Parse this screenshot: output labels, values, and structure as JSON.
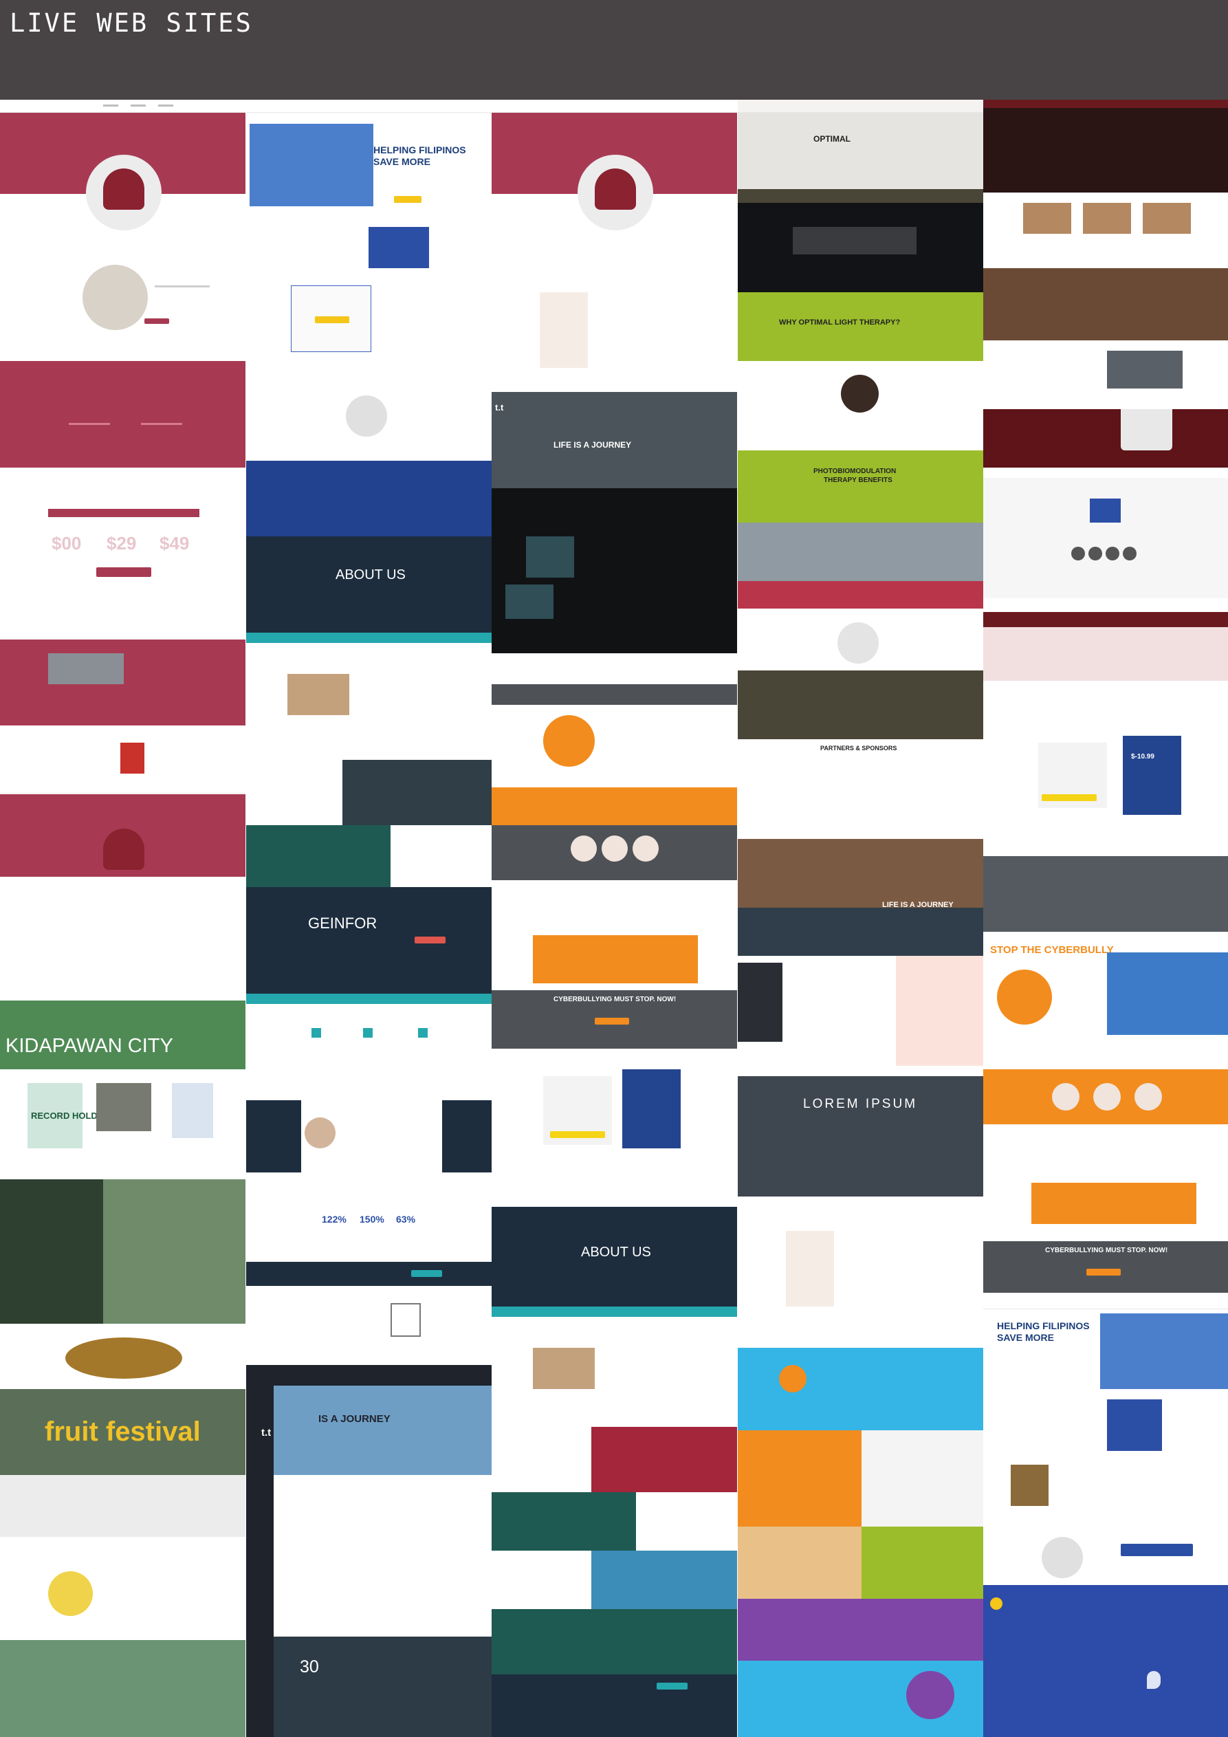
{
  "header": {
    "title": "LIVE WEB SITES"
  },
  "colors": {
    "header_bg": "#484446",
    "maroon": "#a73a52",
    "navy": "#1f3b74",
    "blue": "#2c4fa6",
    "teal": "#24a7ad",
    "orange": "#f28c1e",
    "lime": "#9bbd2c",
    "purple": "#7f46a8",
    "sky": "#35b5e6",
    "dark": "#2b2f36",
    "green": "#5e8f6e"
  },
  "sites": {
    "helping_1": {
      "title": "HELPING FILIPINOS",
      "subtitle": "SAVE MORE"
    },
    "helping_2": {
      "title": "HELPING FILIPINOS",
      "subtitle": "SAVE MORE"
    },
    "about_1": {
      "title": "ABOUT US"
    },
    "about_2": {
      "title": "ABOUT US"
    },
    "geinfor": {
      "title": "GEINFOR"
    },
    "stats": {
      "values": [
        "122%",
        "150%",
        "63%"
      ]
    },
    "journey_1": {
      "title": "IS A JOURNEY"
    },
    "journey_2": {
      "title": "LIFE IS A JOURNEY"
    },
    "journey_3": {
      "title": "LIFE IS A JOURNEY"
    },
    "day_number": {
      "value": "30"
    },
    "lorem_1": {
      "title": "LOREM IPSUM"
    },
    "cyberbullying_1": {
      "title": "CYBERBULLYING MUST STOP. NOW!"
    },
    "cyberbullying_2": {
      "title": "CYBERBULLYING MUST STOP. NOW!"
    },
    "stop_bully": {
      "title": "STOP THE CYBERBULLY"
    },
    "optimal": {
      "title": "OPTIMAL"
    },
    "why_optimal": {
      "title": "WHY OPTIMAL LIGHT THERAPY?"
    },
    "photobio": {
      "title": "PHOTOBIOMODULATION",
      "subtitle": "THERAPY BENEFITS"
    },
    "partners": {
      "title": "PARTNERS & SPONSORS"
    },
    "kidapawan": {
      "title": "KIDAPAWAN CITY"
    },
    "record_holder": {
      "title": "RECORD HOLDER"
    },
    "fruit_festival": {
      "title": "fruit festival"
    },
    "prices": {
      "values": [
        "$00",
        "$29",
        "$49"
      ]
    },
    "pricing_2": {
      "value": "$-10.99"
    },
    "tt_logo": {
      "text": "t.t"
    }
  }
}
